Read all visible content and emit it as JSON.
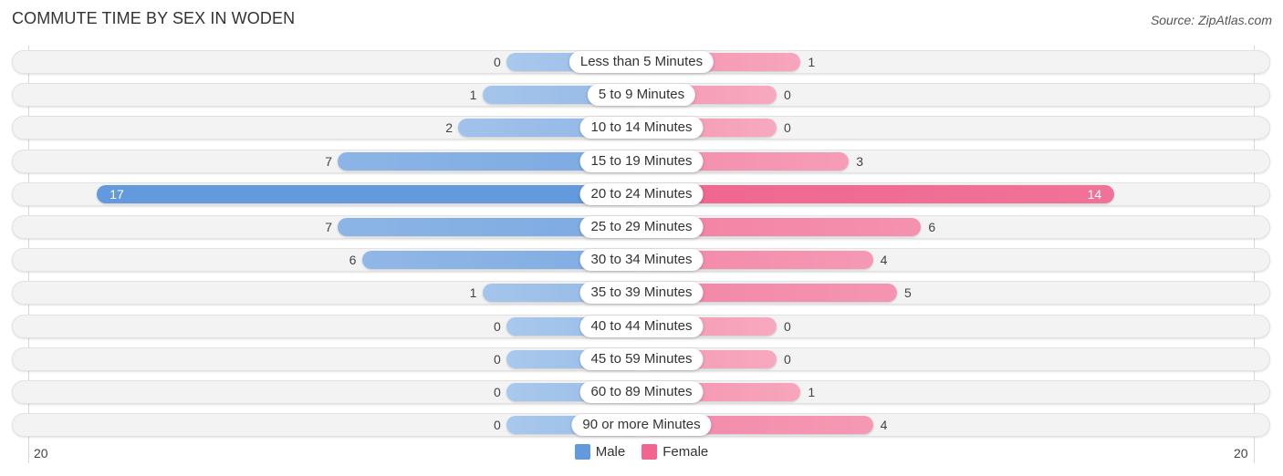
{
  "chart_data": {
    "type": "bar",
    "orientation": "horizontal-diverging",
    "title": "COMMUTE TIME BY SEX IN WODEN",
    "source": "Source: ZipAtlas.com",
    "categories": [
      "Less than 5 Minutes",
      "5 to 9 Minutes",
      "10 to 14 Minutes",
      "15 to 19 Minutes",
      "20 to 24 Minutes",
      "25 to 29 Minutes",
      "30 to 34 Minutes",
      "35 to 39 Minutes",
      "40 to 44 Minutes",
      "45 to 59 Minutes",
      "60 to 89 Minutes",
      "90 or more Minutes"
    ],
    "series": [
      {
        "name": "Male",
        "side": "left",
        "color": "#6399dd",
        "light_color": "#a9c8ec",
        "values": [
          0,
          1,
          2,
          7,
          17,
          7,
          6,
          1,
          0,
          0,
          0,
          0
        ]
      },
      {
        "name": "Female",
        "side": "right",
        "color": "#f06690",
        "light_color": "#f7a9c0",
        "values": [
          1,
          0,
          0,
          3,
          14,
          6,
          4,
          5,
          0,
          0,
          1,
          4
        ]
      }
    ],
    "axis": {
      "left_tick": "20",
      "right_tick": "20",
      "max": 20
    },
    "legend": {
      "position": "bottom-center",
      "items": [
        "Male",
        "Female"
      ]
    },
    "grid": false
  }
}
